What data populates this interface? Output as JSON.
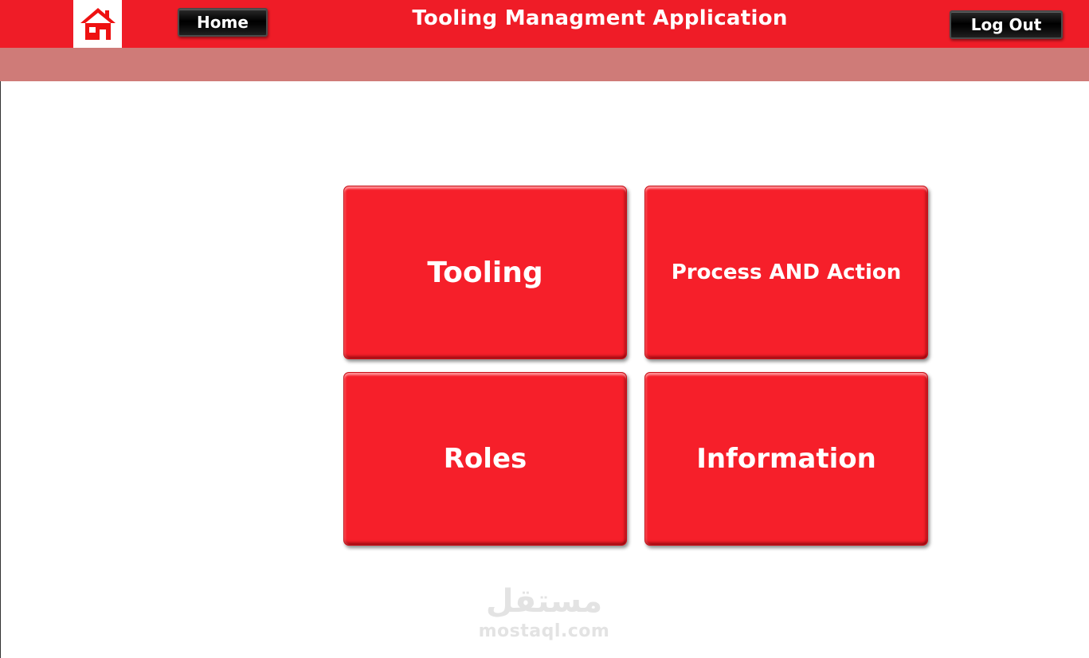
{
  "header": {
    "home_icon": "house-icon",
    "home_label": "Home",
    "title": "Tooling Managment Application",
    "logout_label": "Log Out"
  },
  "menu": {
    "tiles": [
      {
        "label": "Tooling"
      },
      {
        "label": "Process AND Action"
      },
      {
        "label": "Roles"
      },
      {
        "label": "Information"
      }
    ]
  },
  "watermark": {
    "arabic": "مستقل",
    "latin": "mostaql.com"
  },
  "colors": {
    "header_red": "#ef1c27",
    "subbar_rose": "#cf7b78",
    "tile_red": "#f61f2a",
    "button_black": "#000000"
  }
}
